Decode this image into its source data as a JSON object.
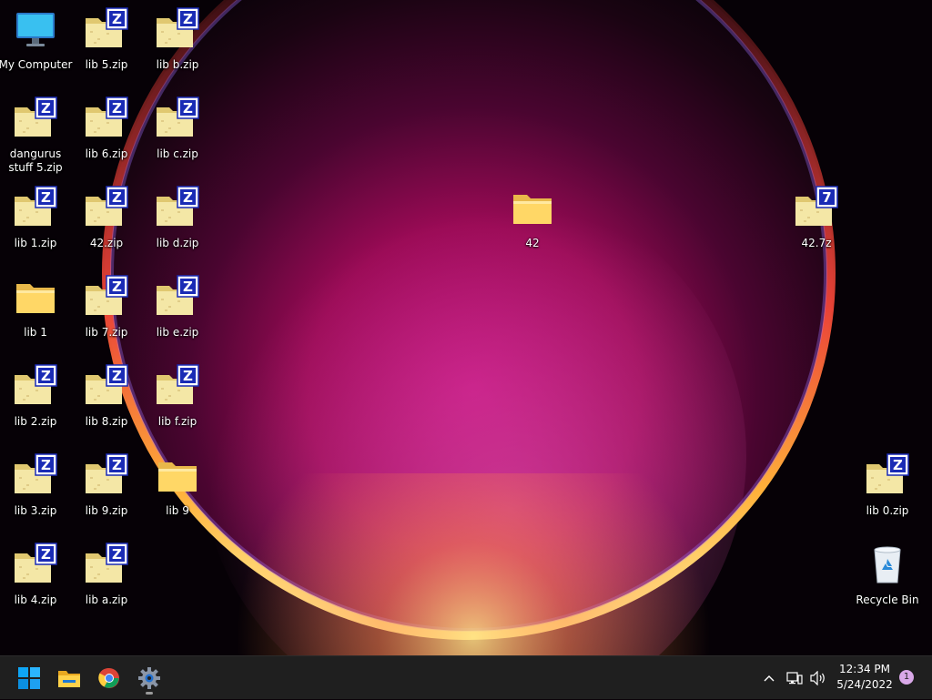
{
  "desktop": {
    "icons": [
      {
        "label": "My Computer",
        "type": "computer"
      },
      {
        "label": "lib 5.zip",
        "type": "zip"
      },
      {
        "label": "lib b.zip",
        "type": "zip"
      },
      {
        "label": "dangurus stuff 5.zip",
        "type": "zip"
      },
      {
        "label": "lib 6.zip",
        "type": "zip"
      },
      {
        "label": "lib c.zip",
        "type": "zip"
      },
      {
        "label": "lib 1.zip",
        "type": "zip"
      },
      {
        "label": "42.zip",
        "type": "zip"
      },
      {
        "label": "lib d.zip",
        "type": "zip"
      },
      {
        "label": "42",
        "type": "folder"
      },
      {
        "label": "42.7z",
        "type": "7z"
      },
      {
        "label": "lib 1",
        "type": "folder"
      },
      {
        "label": "lib 7.zip",
        "type": "zip"
      },
      {
        "label": "lib e.zip",
        "type": "zip"
      },
      {
        "label": "lib 2.zip",
        "type": "zip"
      },
      {
        "label": "lib 8.zip",
        "type": "zip"
      },
      {
        "label": "lib f.zip",
        "type": "zip"
      },
      {
        "label": "lib 3.zip",
        "type": "zip"
      },
      {
        "label": "lib 9.zip",
        "type": "zip"
      },
      {
        "label": "lib 9",
        "type": "folder"
      },
      {
        "label": "lib 0.zip",
        "type": "zip"
      },
      {
        "label": "lib 4.zip",
        "type": "zip"
      },
      {
        "label": "lib a.zip",
        "type": "zip"
      },
      {
        "label": "Recycle Bin",
        "type": "recycle-bin"
      }
    ]
  },
  "taskbar": {
    "apps": [
      {
        "name": "start",
        "icon": "windows-logo-icon"
      },
      {
        "name": "file-explorer",
        "icon": "folder-icon"
      },
      {
        "name": "chrome",
        "icon": "chrome-icon"
      },
      {
        "name": "settings",
        "icon": "gear-icon"
      }
    ],
    "tray": {
      "time": "12:34 PM",
      "date": "5/24/2022",
      "notification_count": "1"
    }
  },
  "colors": {
    "taskbar_bg": "#1f1f1f",
    "accent_blue": "#0078d4",
    "folder_yellow": "#f5c842"
  }
}
